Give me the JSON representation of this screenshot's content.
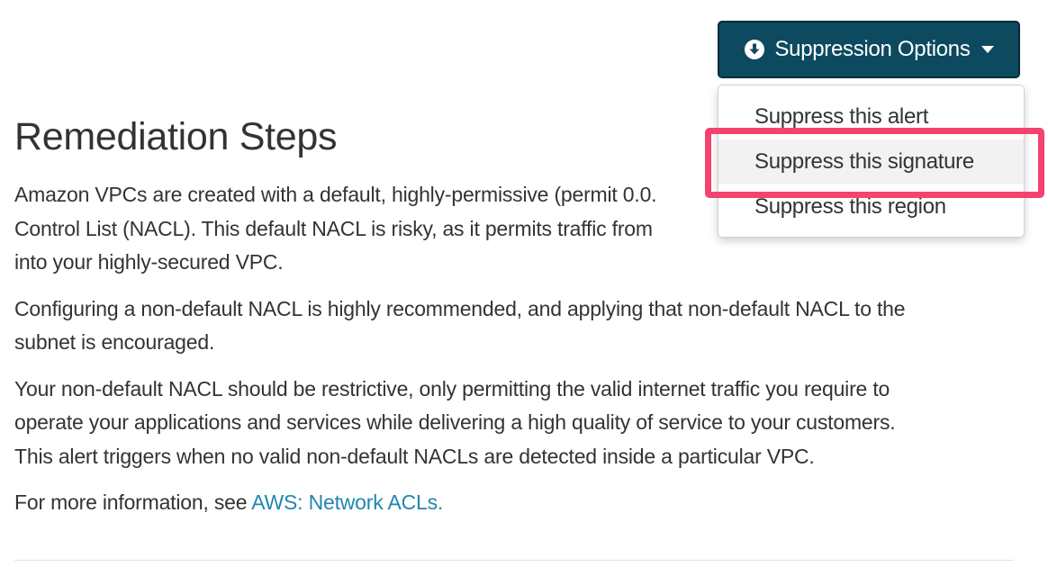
{
  "section": {
    "heading": "Remediation Steps",
    "paragraphs": [
      {
        "lines": [
          "Amazon VPCs are created with a default, highly-permissive (permit 0.0.",
          "Control List (NACL). This default NACL is risky, as it permits traffic from",
          "into your highly-secured VPC."
        ]
      },
      {
        "lines": [
          "Configuring a non-default NACL is highly recommended, and applying that non-default NACL to the",
          "subnet is encouraged."
        ]
      },
      {
        "lines": [
          "Your non-default NACL should be restrictive, only permitting the valid internet traffic you require to",
          "operate your applications and services while delivering a high quality of service to your customers.",
          "This alert triggers when no valid non-default NACLs are detected inside a particular VPC."
        ]
      }
    ],
    "more_info": {
      "prefix": "For more information, see ",
      "link_label": "AWS: Network ACLs."
    }
  },
  "suppression": {
    "button_label": "Suppression Options",
    "button_icon": "download-circle-icon",
    "caret_icon": "caret-down-icon",
    "menu_items": [
      {
        "label": "Suppress this alert"
      },
      {
        "label": "Suppress this signature"
      },
      {
        "label": "Suppress this region"
      }
    ]
  },
  "colors": {
    "button_bg": "#0d4a60",
    "link": "#1f87b1",
    "highlight": "#f5426f"
  }
}
